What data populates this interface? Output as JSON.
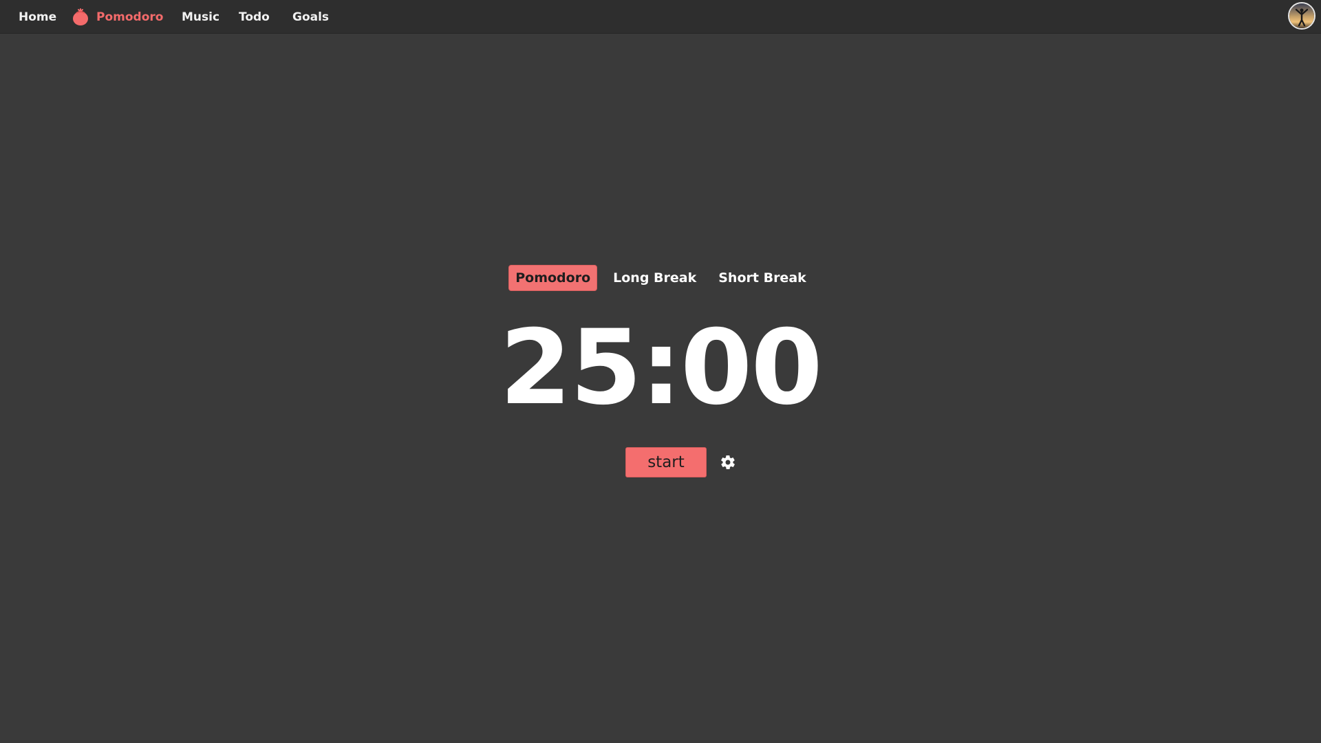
{
  "nav": {
    "items": [
      {
        "label": "Home",
        "active": false
      },
      {
        "label": "Pomodoro",
        "active": true,
        "icon": "tomato-icon"
      },
      {
        "label": "Music",
        "active": false
      },
      {
        "label": "Todo",
        "active": false
      },
      {
        "label": "Goals",
        "active": false
      }
    ],
    "avatar_icon": "user-avatar"
  },
  "timer": {
    "tabs": [
      {
        "label": "Pomodoro",
        "active": true
      },
      {
        "label": "Long Break",
        "active": false
      },
      {
        "label": "Short Break",
        "active": false
      }
    ],
    "display": "25:00",
    "start_label": "start",
    "settings_icon": "gear-icon"
  },
  "colors": {
    "background": "#3a3a3a",
    "topbar": "#2e2e2e",
    "accent": "#f46e6e",
    "text": "#ffffff"
  }
}
